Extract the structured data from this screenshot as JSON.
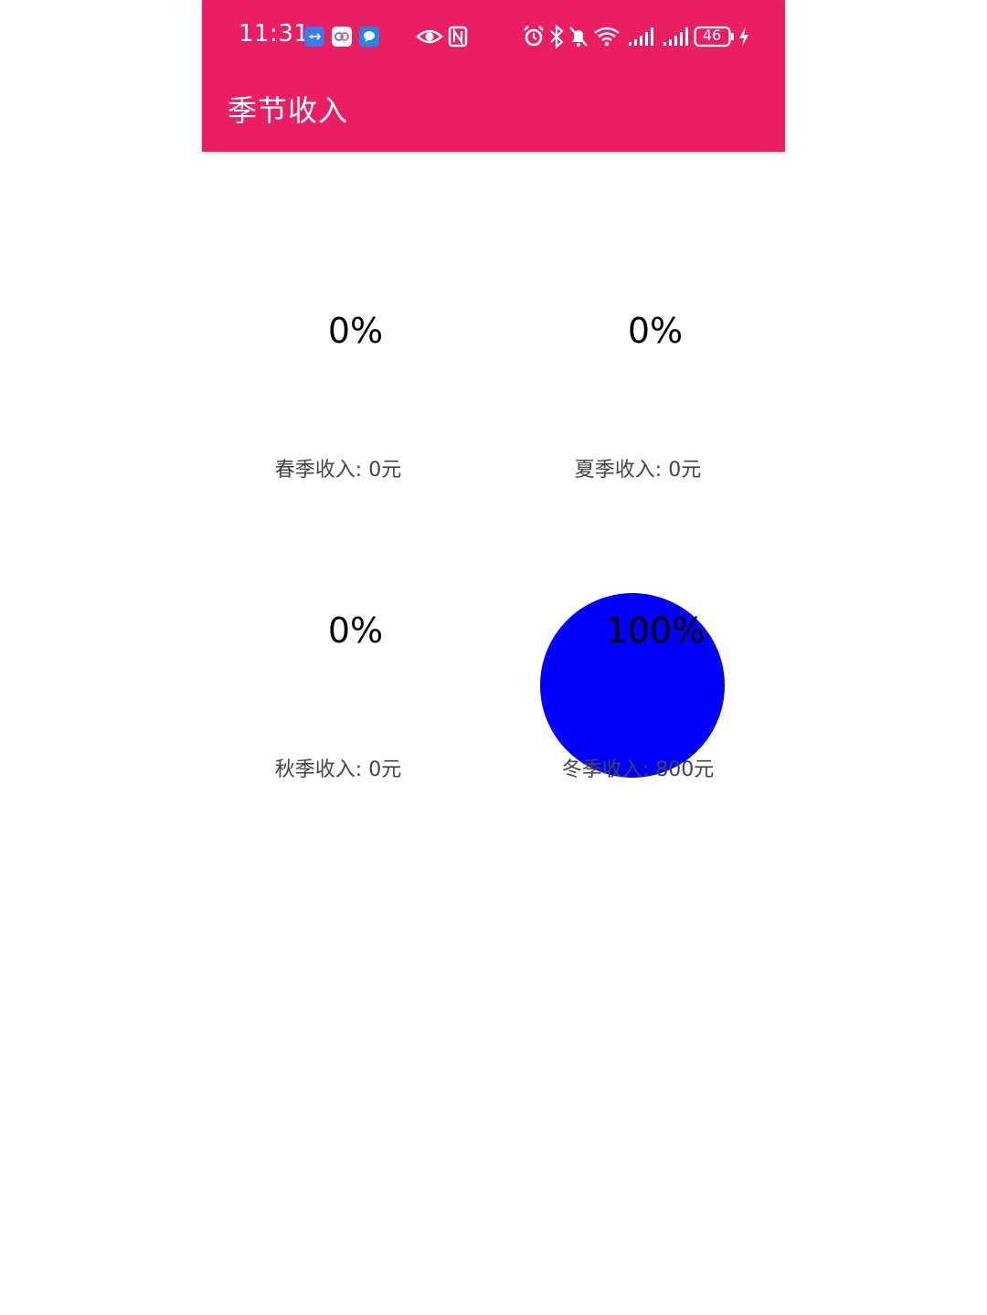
{
  "status_bar": {
    "time": "11:31",
    "battery": "46"
  },
  "app_bar": {
    "title": "季节收入",
    "color": "#E91E63"
  },
  "seasons": [
    {
      "percent": "0%",
      "caption": "春季收入: 0元",
      "share": 0
    },
    {
      "percent": "0%",
      "caption": "夏季收入: 0元",
      "share": 0
    },
    {
      "percent": "0%",
      "caption": "秋季收入: 0元",
      "share": 0
    },
    {
      "percent": "100%",
      "caption": "冬季收入: 800元",
      "share": 1
    }
  ],
  "pie_color": "#0000FF"
}
